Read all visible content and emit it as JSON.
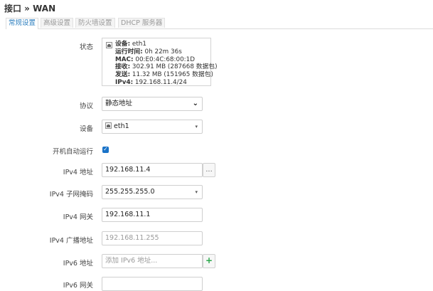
{
  "page": {
    "title": "接口 » WAN"
  },
  "tabs": [
    {
      "label": "常规设置",
      "active": true
    },
    {
      "label": "高级设置",
      "active": false
    },
    {
      "label": "防火墙设置",
      "active": false
    },
    {
      "label": "DHCP 服务器",
      "active": false
    }
  ],
  "status": {
    "label": "状态",
    "icon": "ethernet-port-icon",
    "lines": [
      {
        "key": "设备:",
        "value": "eth1"
      },
      {
        "key": "运行时间:",
        "value": "0h 22m 36s"
      },
      {
        "key": "MAC:",
        "value": "00:E0:4C:68:00:1D"
      },
      {
        "key": "接收:",
        "value": "302.91 MB (287668 数据包)"
      },
      {
        "key": "发送:",
        "value": "11.32 MB (151965 数据包)"
      },
      {
        "key": "IPv4:",
        "value": "192.168.11.4/24"
      }
    ]
  },
  "form": {
    "protocol": {
      "label": "协议",
      "value": "静态地址"
    },
    "device": {
      "label": "设备",
      "value": "eth1"
    },
    "autostart": {
      "label": "开机自动运行",
      "checked": true
    },
    "ipv4_addr": {
      "label": "IPv4 地址",
      "value": "192.168.11.4",
      "button": "..."
    },
    "ipv4_mask": {
      "label": "IPv4 子网掩码",
      "value": "255.255.255.0"
    },
    "ipv4_gw": {
      "label": "IPv4 网关",
      "value": "192.168.11.1"
    },
    "ipv4_bcast": {
      "label": "IPv4 广播地址",
      "placeholder": "192.168.11.255"
    },
    "ipv6_addr": {
      "label": "IPv6 地址",
      "placeholder": "添加 IPv6 地址...",
      "button": "+"
    },
    "ipv6_gw": {
      "label": "IPv6 网关"
    }
  },
  "colors": {
    "accent": "#2e7fbf",
    "checkbox": "#1a73c8",
    "add": "#2aa84a"
  }
}
